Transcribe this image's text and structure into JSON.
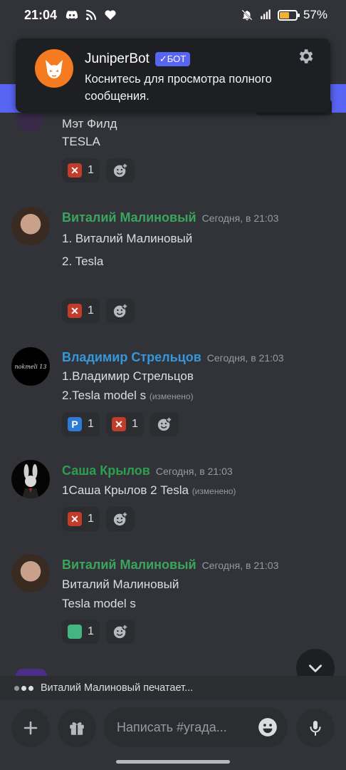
{
  "status_bar": {
    "time": "21:04",
    "battery": "57%",
    "battery_level": 0.57
  },
  "notification": {
    "app": "JuniperBot",
    "badge": "✓БОТ",
    "body": "Коснитесь для просмотра полного сообщения."
  },
  "top_partial": {
    "line1": "Мэт Филд",
    "line2": "TESLA",
    "reaction_count": "1"
  },
  "messages": [
    {
      "author": "Виталий Малиновый",
      "author_color": "#3ba55d",
      "timestamp": "Сегодня, в 21:03",
      "lines": [
        "1.  Виталий Малиновый",
        "2.  Tesla"
      ],
      "reactions": [
        {
          "emoji": "dota-icon",
          "count": "1"
        }
      ]
    },
    {
      "author": "Владимир Стрельцов",
      "author_color": "#3498db",
      "timestamp": "Сегодня, в 21:03",
      "avatar_text": "nokmeli 13",
      "lines": [
        "1.Владимир Стрельцов",
        "2.Tesla model s"
      ],
      "edited": "(изменено)",
      "reactions": [
        {
          "emoji": "parking-icon",
          "count": "1"
        },
        {
          "emoji": "dota-icon",
          "count": "1"
        }
      ]
    },
    {
      "author": "Саша Крылов",
      "author_color": "#2e9e4f",
      "timestamp": "Сегодня, в 21:03",
      "lines": [
        "1Саша Крылов  2 Tesla"
      ],
      "edited": "(изменено)",
      "reactions": [
        {
          "emoji": "dota-icon",
          "count": "1"
        }
      ]
    },
    {
      "author": "Виталий Малиновый",
      "author_color": "#3ba55d",
      "timestamp": "Сегодня, в 21:03",
      "lines": [
        "Виталий Малиновый",
        "Tesla model s"
      ],
      "reactions": [
        {
          "emoji": "green-square-icon",
          "count": "1"
        }
      ]
    }
  ],
  "typing": "Виталий Малиновый печатает...",
  "composer": {
    "placeholder": "Написать #угада..."
  },
  "colors": {
    "background": "#313338",
    "accent": "#5865f2",
    "reaction_bg": "#2b2d31"
  }
}
